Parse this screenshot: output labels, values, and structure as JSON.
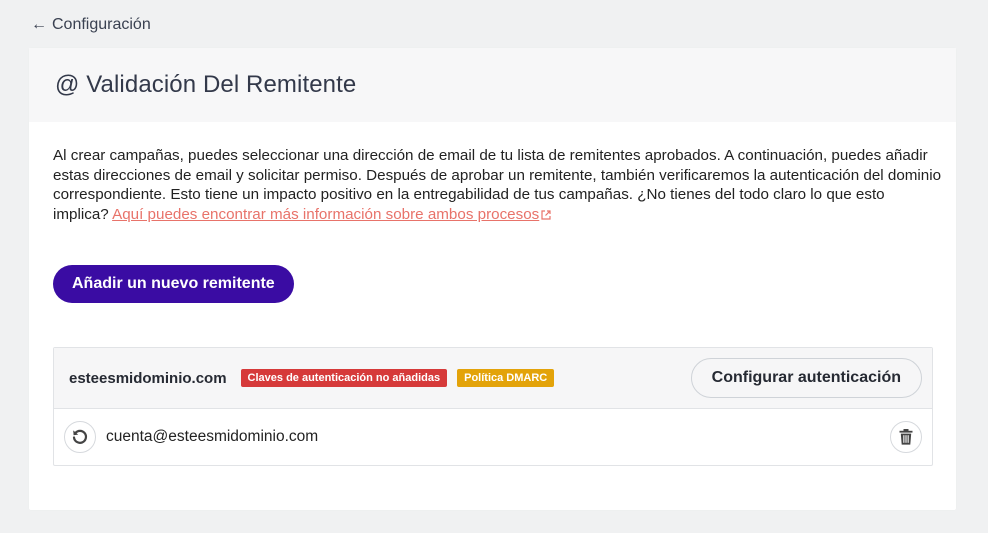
{
  "nav": {
    "back_label": "Configuración",
    "back_icon": "arrow-left-icon"
  },
  "card": {
    "title": "@ Validación Del Remitente",
    "description": "Al crear campañas, puedes seleccionar una dirección de email de tu lista de remitentes aprobados. A continuación, puedes añadir estas direcciones de email y solicitar permiso. Después de aprobar un remitente, también verificaremos la autenticación del dominio correspondiente. Esto tiene un impacto positivo en la entregabilidad de tus campañas. ¿No tienes del todo claro lo que esto implica? ",
    "link_text": "Aquí puedes encontrar más información sobre ambos procesos",
    "add_button_label": "Añadir un nuevo remitente"
  },
  "sender": {
    "domain": "esteesmidominio.com",
    "badges": [
      {
        "label": "Claves de autenticación no añadidas",
        "color": "#d63a3a"
      },
      {
        "label": "Política DMARC",
        "color": "#e3a30a"
      }
    ],
    "configure_button_label": "Configurar autenticación",
    "email": "cuenta@esteesmidominio.com",
    "icons": [
      "undo-icon",
      "trash-icon",
      "external-link-icon"
    ]
  },
  "colors": {
    "primary_button": "#3a0ca3",
    "link": "#e8736a",
    "background": "#f0f1f2"
  }
}
